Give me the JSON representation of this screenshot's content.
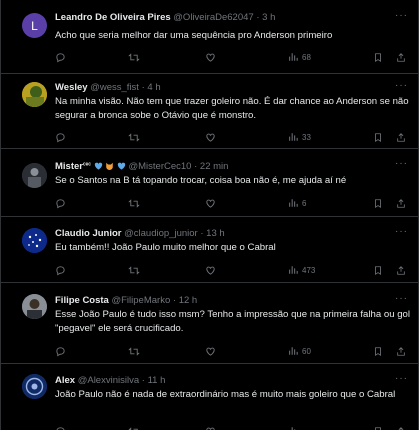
{
  "tweets": [
    {
      "name": "Leandro De Oliveira Pires",
      "handle": "@OliveiraDe62047",
      "time": "3 h",
      "text": "Acho que seria melhor dar uma sequência pro Anderson primeiro",
      "views": "68",
      "avatar": {
        "type": "letter",
        "letter": "L",
        "color": "#5b3fa8"
      }
    },
    {
      "name": "Wesley",
      "handle": "@wess_fist",
      "time": "4 h",
      "text": "Na minha visão. Não tem que trazer goleiro não. É dar chance ao Anderson se não segurar a bronca sobe o Otávio que é monstro.",
      "views": "33",
      "avatar": {
        "type": "photo",
        "color": "#b8a020"
      }
    },
    {
      "name": "Mister",
      "name_suffix": "ᶜᵉᶜ",
      "handle": "@MisterCec10",
      "time": "22 min",
      "text": "Se o Santos na B tá topando trocar, coisa boa não é, me ajuda aí né",
      "views": "6",
      "avatar": {
        "type": "photo",
        "color": "#3a3d45"
      }
    },
    {
      "name": "Claudio Junior",
      "handle": "@claudiop_junior",
      "time": "13 h",
      "text": "Eu também!! João Paulo muito melhor que o Cabral",
      "views": "473",
      "avatar": {
        "type": "flag",
        "color": "#0d2a8a"
      }
    },
    {
      "name": "Filipe Costa",
      "handle": "@FilipeMarko",
      "time": "12 h",
      "text": "Esse João Paulo é tudo isso msm? Tenho a impressão que na primeira falha ou gol \"pegavel\" ele será crucificado.",
      "views": "60",
      "avatar": {
        "type": "photo",
        "color": "#5a5f66"
      }
    },
    {
      "name": "Alex",
      "handle": "@Alexvinisilva",
      "time": "11 h",
      "text": "João Paulo não é nada de extraordinário mas é muito mais goleiro que o Cabral",
      "views": "",
      "avatar": {
        "type": "badge",
        "color": "#1d3f8f"
      }
    }
  ],
  "labels": {
    "separator": "·",
    "more": "···"
  },
  "colors": {
    "background": "#000000",
    "text": "#e7e9ea",
    "muted": "#71767b",
    "border": "#2f3336"
  },
  "icons": [
    "reply-icon",
    "retweet-icon",
    "like-icon",
    "views-icon",
    "bookmark-icon",
    "share-icon",
    "more-icon"
  ]
}
